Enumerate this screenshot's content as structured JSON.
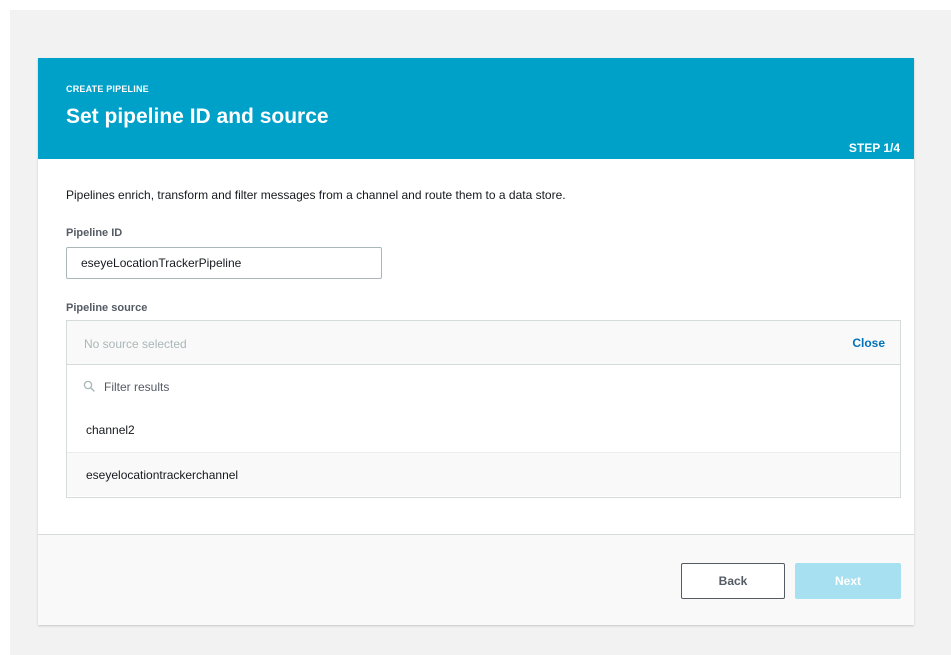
{
  "header": {
    "eyebrow": "CREATE PIPELINE",
    "title": "Set pipeline ID and source",
    "step": "STEP 1/4",
    "color": "#00a1c9"
  },
  "description": "Pipelines enrich, transform and filter messages from a channel and route them to a data store.",
  "pipeline_id": {
    "label": "Pipeline ID",
    "value": "eseyeLocationTrackerPipeline"
  },
  "pipeline_source": {
    "label": "Pipeline source",
    "placeholder": "No source selected",
    "close_label": "Close",
    "filter_placeholder": "Filter results",
    "options": [
      "channel2",
      "eseyelocationtrackerchannel"
    ]
  },
  "footer": {
    "back_label": "Back",
    "next_label": "Next"
  },
  "icons": {
    "filter": "search-icon"
  }
}
